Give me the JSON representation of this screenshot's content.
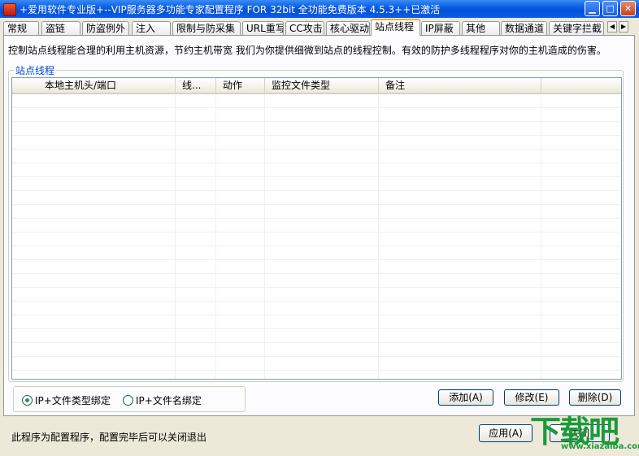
{
  "window": {
    "title": "+爱用软件专业版+--VIP服务器多功能专家配置程序 FOR 32bit 全功能免费版本 4.5.3++已激活",
    "min_glyph": "▁",
    "max_glyph": "□",
    "close_glyph": "✕"
  },
  "tabs": [
    {
      "label": "常规"
    },
    {
      "label": "盗链"
    },
    {
      "label": "防盗例外"
    },
    {
      "label": "注入"
    },
    {
      "label": "限制与防采集"
    },
    {
      "label": "URL重写"
    },
    {
      "label": "CC攻击"
    },
    {
      "label": "核心驱动"
    },
    {
      "label": "站点线程"
    },
    {
      "label": "IP屏蔽"
    },
    {
      "label": "其他"
    },
    {
      "label": "数据通道"
    },
    {
      "label": "关键字拦截"
    }
  ],
  "tab_scroll": {
    "left": "◀",
    "right": "▶"
  },
  "active_tab": "站点线程",
  "page": {
    "description": "控制站点线程能合理的利用主机资源，节约主机带宽 我们为你提供细微到站点的线程控制。有效的防护多线程程序对你的主机造成的伤害。",
    "group_label": "站点线程",
    "columns": [
      {
        "label": "本地主机头/端口"
      },
      {
        "label": "线..."
      },
      {
        "label": "动作"
      },
      {
        "label": "监控文件类型"
      },
      {
        "label": "备注"
      },
      {
        "label": ""
      }
    ],
    "rows": [],
    "radios": [
      {
        "label": "IP+文件类型绑定",
        "checked": true
      },
      {
        "label": "IP+文件名绑定",
        "checked": false
      }
    ],
    "buttons": {
      "add": "添加(A)",
      "edit": "修改(E)",
      "delete": "删除(D)"
    }
  },
  "footer": {
    "status": "此程序为配置程序，配置完毕后可以关闭退出",
    "apply": "应用(A)",
    "close": "关闭"
  },
  "watermark": {
    "text": "下载吧",
    "url_text": "www.xiazaiba.com"
  }
}
